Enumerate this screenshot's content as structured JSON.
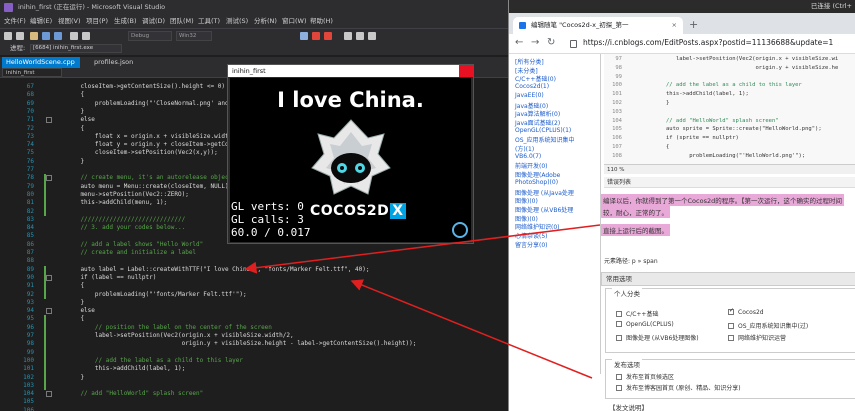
{
  "vs": {
    "title": "inihin_first (正在运行) - Microsoft Visual Studio",
    "menu": [
      "文件(F)",
      "编辑(E)",
      "视图(V)",
      "项目(P)",
      "生成(B)",
      "调试(D)",
      "团队(M)",
      "工具(T)",
      "测试(S)",
      "分析(N)",
      "窗口(W)",
      "帮助(H)"
    ],
    "toolbar": {
      "config": "Debug",
      "platform": "Win32"
    },
    "process_label": "进程:",
    "process_value": "[6684] inihin_first.exe",
    "tabs": [
      "HelloWorldScene.cpp",
      "profiles.json"
    ],
    "scope": "inihin_first",
    "line_numbers": [
      "67",
      "68",
      "69",
      "70",
      "71",
      "72",
      "73",
      "74",
      "75",
      "76",
      "77",
      "78",
      "79",
      "80",
      "81",
      "82",
      "83",
      "84",
      "85",
      "86",
      "87",
      "88",
      "89",
      "90",
      "91",
      "92",
      "93",
      "94",
      "95",
      "96",
      "97",
      "98",
      "99",
      "100",
      "101",
      "102",
      "103",
      "104",
      "105",
      "106"
    ],
    "code": [
      "    closeItem->getContentSize().height <= 0)",
      "    {",
      "        problemLoading(\"'CloseNormal.png' and 'Cl",
      "    }",
      "    else",
      "    {",
      "        float x = origin.x + visibleSize.width - c",
      "        float y = origin.y + closeItem->getContent",
      "        closeItem->setPosition(Vec2(x,y));",
      "    }",
      "",
      "    // create menu, it's an autorelease object",
      "    auto menu = Menu::create(closeItem, NULL);",
      "    menu->setPosition(Vec2::ZERO);",
      "    this->addChild(menu, 1);",
      "",
      "    /////////////////////////////",
      "    // 3. add your codes below...",
      "",
      "    // add a label shows \"Hello World\"",
      "    // create and initialize a label",
      "",
      "    auto label = Label::createWithTTF(\"I love China.\", \"fonts/Marker Felt.ttf\", 40);",
      "    if (label == nullptr)",
      "    {",
      "        problemLoading(\"'fonts/Marker Felt.ttf'\");",
      "    }",
      "    else",
      "    {",
      "        // position the label on the center of the screen",
      "        label->setPosition(Vec2(origin.x + visibleSize.width/2,",
      "                                origin.y + visibleSize.height - label->getContentSize().height));",
      "",
      "        // add the label as a child to this layer",
      "        this->addChild(label, 1);",
      "    }",
      "",
      "    // add \"HelloWorld\" splash screen\"",
      "",
      ""
    ]
  },
  "cocos": {
    "window_title": "inihin_first",
    "headline": "I love China.",
    "gl_verts_label": "GL verts:",
    "gl_verts_value": "0",
    "gl_calls_label": "GL calls:",
    "gl_calls_value": "3",
    "fps": "60.0 / 0.017",
    "logo_text": "COCOS2D",
    "logo_x": "X"
  },
  "browser": {
    "top_bar": "已连接 (Ctrl+",
    "tab_title": "编辑随笔 \"Cocos2d-x_初探_第一",
    "url": "https://i.cnblogs.com/EditPosts.aspx?postid=11136688&update=1",
    "categories": [
      "[所有分类]",
      "[未分类]",
      "C/C++基础(0)",
      "Cocos2d(1)",
      "JavaEE(0)",
      "Java基础(0)",
      "Java算法解析(0)",
      "Java面试基础(2)",
      "OpenGL(CPLUS)(1)",
      "OS_应用系统知识集中",
      "(方)(1)",
      "VB6.0(7)",
      "前端开发(0)",
      "图像处理(Adobe",
      "PhotoShop)(0)",
      "图像处理 (从Java处理",
      "图像)(0)",
      "图像处理 (从VB6处理",
      "图像)(0)",
      "网络维护知识(0)",
      "心情杂谈(5)",
      "留言分享(0)"
    ],
    "editor_line_numbers": [
      "97",
      "98",
      "99",
      "100",
      "101",
      "102",
      "103",
      "104",
      "105",
      "106",
      "107",
      "108"
    ],
    "editor_code": [
      "label->setPosition(Vec2(origin.x + visibleSize.wi",
      "                        origin.y + visibleSize.he",
      "",
      "// add the label as a child to this layer",
      "this->addChild(label, 1);",
      "}",
      "",
      "// add \"HelloWorld\" splash screen\"",
      "auto sprite = Sprite::create(\"HelloWorld.png\");",
      "if (sprite == nullptr)",
      "{",
      "    problemLoading(\"'HelloWorld.png'\");"
    ],
    "zoom": "110 %",
    "error_bar": "错误列表",
    "content_line1": "编译以后，你就得到了第一个Cocos2d的程序。【第一次运行，这个确实的过程时间",
    "content_line2": "较，耐心，正常的了。",
    "content_line3": "直接上运行后的截图。",
    "element_path": "元素路径: p » span",
    "options_header": "常用选项",
    "personal_category": "个人分类",
    "checkboxes": [
      {
        "label": "C/C++基础",
        "checked": false
      },
      {
        "label": "Cocos2d",
        "checked": true
      },
      {
        "label": "OpenGL(CPLUS)",
        "checked": false
      },
      {
        "label": "OS_应用系统知识集中(过)",
        "checked": false
      },
      {
        "label": "图像处理 (从VB6处理图像)",
        "checked": false
      },
      {
        "label": "网络维护知识运营",
        "checked": false
      }
    ],
    "publish_options": "发布选项",
    "publish_checkboxes": [
      {
        "label": "发布至首页候选区",
        "checked": false
      },
      {
        "label": "发布至博客园首页 (原创、精品、知识分享)",
        "checked": false
      }
    ],
    "more_options": "【发文说明】"
  }
}
